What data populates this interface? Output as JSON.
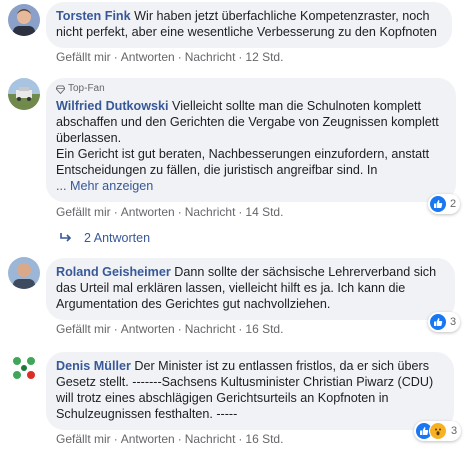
{
  "comments": [
    {
      "author": "Torsten Fink",
      "text": "Wir haben jetzt überfachliche Kompetenzraster, noch nicht perfekt, aber eine wesentliche Verbesserung zu den Kopfnoten",
      "actions": {
        "like": "Gefällt mir",
        "reply": "Antworten",
        "message": "Nachricht",
        "time": "12 Std."
      }
    },
    {
      "badge": "Top-Fan",
      "author": "Wilfried Dutkowski",
      "text": "Vielleicht sollte man die Schulnoten komplett abschaffen und den Gerichten die Vergabe von Zeugnissen komplett überlassen.",
      "text2": "Ein Gericht ist gut beraten, Nachbesserungen einzufordern, anstatt Entscheidungen zu fällen, die juristisch angreifbar sind. In",
      "more": "... Mehr anzeigen",
      "actions": {
        "like": "Gefällt mir",
        "reply": "Antworten",
        "message": "Nachricht",
        "time": "14 Std."
      },
      "reaction_count": "2",
      "replies": "2 Antworten"
    },
    {
      "author": "Roland Geisheimer",
      "text": "Dann sollte der sächsische Lehrerverband sich das Urteil mal erklären lassen, vielleicht hilft es ja. Ich kann die Argumentation des Gerichtes gut nachvollziehen.",
      "actions": {
        "like": "Gefällt mir",
        "reply": "Antworten",
        "message": "Nachricht",
        "time": "16 Std."
      },
      "reaction_count": "3"
    },
    {
      "author": "Denis Müller",
      "text": "Der Minister ist zu entlassen fristlos, da er sich übers Gesetz stellt. -------Sachsens Kultusminister Christian Piwarz (CDU) will trotz eines abschlägigen Gerichtsurteils an Kopfnoten in Schulzeugnissen festhalten. -----",
      "actions": {
        "like": "Gefällt mir",
        "reply": "Antworten",
        "message": "Nachricht",
        "time": "16 Std."
      },
      "reaction_count": "3"
    }
  ],
  "colors": {
    "author": "#385898",
    "bubble": "#f0f2f5",
    "meta": "#65676b",
    "like": "#1877f2",
    "wow": "#f7b125"
  }
}
